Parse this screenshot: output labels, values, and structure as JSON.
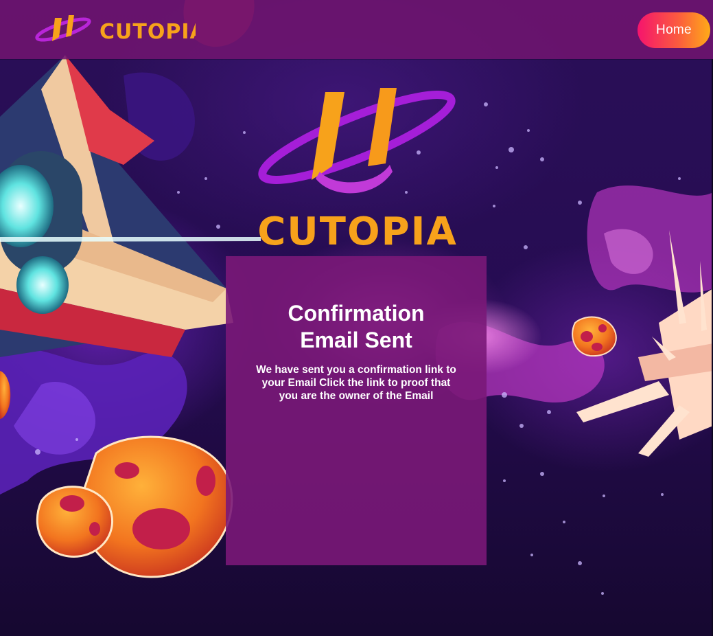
{
  "header": {
    "brand": {
      "text": "CUTOPIA"
    },
    "nav": {
      "home_label": "Home"
    }
  },
  "hero": {
    "logo": {
      "text": "CUTOPIA"
    }
  },
  "confirmation": {
    "title_line1": "Confirmation",
    "title_line2": "Email Sent",
    "message": "We have sent you a confirmation link to your Email Click the link to proof that you are the owner of the Email"
  },
  "colors": {
    "header_bg": "#701470",
    "card_bg": "#7a1878",
    "brand_orange": "#f7a21b",
    "brand_purple": "#b825d8",
    "button_gradient_start": "#f5146d",
    "button_gradient_end": "#ffaa18",
    "background": "#260c52"
  }
}
